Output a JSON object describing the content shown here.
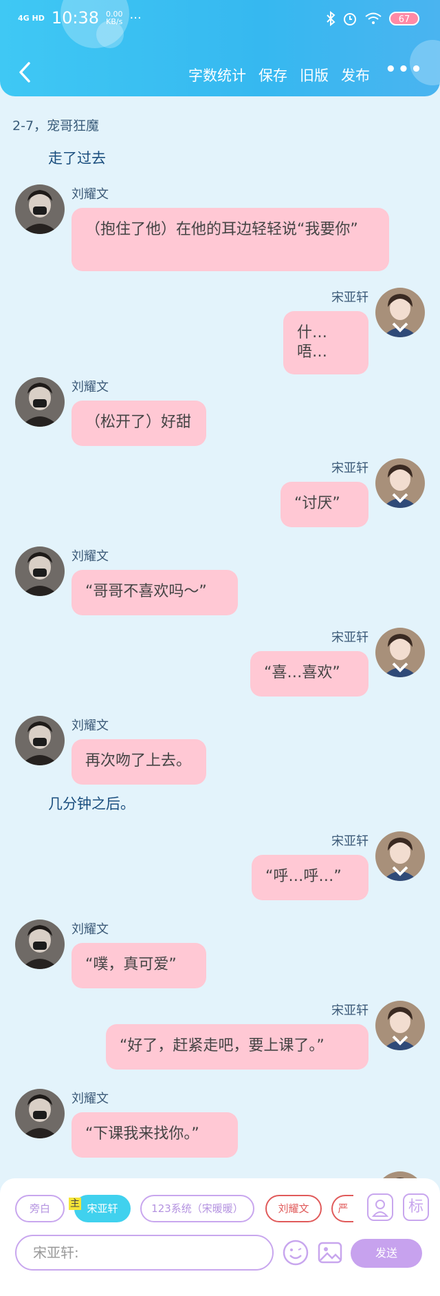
{
  "status_bar": {
    "network": "4G HD",
    "time": "10:38",
    "speed_value": "0.00",
    "speed_unit": "KB/s",
    "dots": "···",
    "battery": "67"
  },
  "nav": {
    "items": [
      "字数统计",
      "保存",
      "旧版",
      "发布"
    ],
    "more": "•••"
  },
  "chapter_title": "2-7，宠哥狂魔",
  "messages": [
    {
      "type": "narration",
      "text": "走了过去"
    },
    {
      "type": "left",
      "name": "刘耀文",
      "text": "（抱住了他）在他的耳边轻轻说“我要你”"
    },
    {
      "type": "right",
      "name": "宋亚轩",
      "text": "什…唔…"
    },
    {
      "type": "left",
      "name": "刘耀文",
      "text": "（松开了）好甜"
    },
    {
      "type": "right",
      "name": "宋亚轩",
      "text": "“讨厌”"
    },
    {
      "type": "left",
      "name": "刘耀文",
      "text": "“哥哥不喜欢吗～”"
    },
    {
      "type": "right",
      "name": "宋亚轩",
      "text": "“喜…喜欢”"
    },
    {
      "type": "left",
      "name": "刘耀文",
      "text": "再次吻了上去。"
    },
    {
      "type": "narration",
      "text": "几分钟之后。"
    },
    {
      "type": "right",
      "name": "宋亚轩",
      "text": "“呼…呼…”"
    },
    {
      "type": "left",
      "name": "刘耀文",
      "text": "“噗，真可爱”"
    },
    {
      "type": "right",
      "name": "宋亚轩",
      "text": "“好了，赶紧走吧，要上课了。”"
    },
    {
      "type": "left",
      "name": "刘耀文",
      "text": "“下课我来找你。”"
    }
  ],
  "role_chips": [
    "旁白",
    "宋亚轩",
    "123系统（宋暖暖）",
    "刘耀文",
    "严"
  ],
  "main_tag": "主",
  "side_buttons": {
    "mark": "标"
  },
  "input_placeholder": "宋亚轩:",
  "send_label": "发送",
  "colors": {
    "header": "#3fc8f4",
    "bubble": "#ffc8d4",
    "accent": "#c7a2ee",
    "active_chip": "#40d1ee"
  }
}
